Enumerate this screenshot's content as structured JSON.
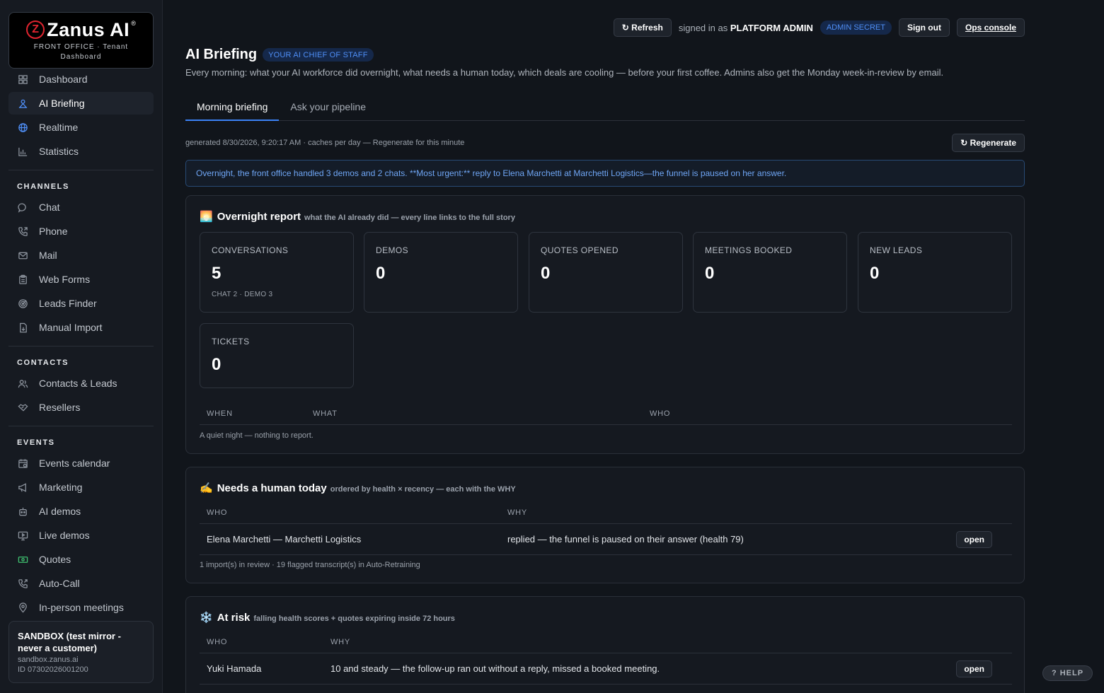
{
  "brand": {
    "name": "Zanus AI",
    "logo_mark": "Z",
    "registered": "®",
    "subtitle": "FRONT OFFICE · Tenant Dashboard"
  },
  "sidebar": {
    "top_items": [
      {
        "label": "Dashboard",
        "icon": "dashboard-icon",
        "active": false
      },
      {
        "label": "AI Briefing",
        "icon": "briefing-icon",
        "active": true
      },
      {
        "label": "Realtime",
        "icon": "globe-icon",
        "active": false
      },
      {
        "label": "Statistics",
        "icon": "bar-chart-icon",
        "active": false
      }
    ],
    "channels_heading": "CHANNELS",
    "channels": [
      {
        "label": "Chat",
        "icon": "chat-icon"
      },
      {
        "label": "Phone",
        "icon": "phone-icon"
      },
      {
        "label": "Mail",
        "icon": "mail-icon"
      },
      {
        "label": "Web Forms",
        "icon": "clipboard-icon"
      },
      {
        "label": "Leads Finder",
        "icon": "radar-icon"
      },
      {
        "label": "Manual Import",
        "icon": "import-icon"
      }
    ],
    "contacts_heading": "CONTACTS",
    "contacts": [
      {
        "label": "Contacts & Leads",
        "icon": "users-icon"
      },
      {
        "label": "Resellers",
        "icon": "handshake-icon"
      }
    ],
    "events_heading": "EVENTS",
    "events": [
      {
        "label": "Events calendar",
        "icon": "calendar-icon"
      },
      {
        "label": "Marketing",
        "icon": "megaphone-icon"
      },
      {
        "label": "AI demos",
        "icon": "robot-icon"
      },
      {
        "label": "Live demos",
        "icon": "monitor-icon"
      },
      {
        "label": "Quotes",
        "icon": "money-icon"
      },
      {
        "label": "Auto-Call",
        "icon": "phone-forward-icon"
      },
      {
        "label": "In-person meetings",
        "icon": "location-pin-icon"
      }
    ]
  },
  "tenant": {
    "name": "SANDBOX (test mirror - never a customer)",
    "domain": "sandbox.zanus.ai",
    "id": "ID 07302026001200"
  },
  "topbar": {
    "refresh_label": "↻ Refresh",
    "signed_in_prefix": "signed in as",
    "user": "PLATFORM ADMIN",
    "role_badge": "ADMIN SECRET",
    "sign_out_label": "Sign out",
    "ops_console_label": "Ops console"
  },
  "page": {
    "title": "AI Briefing",
    "badge": "YOUR AI CHIEF OF STAFF",
    "subtitle": "Every morning: what your AI workforce did overnight, what needs a human today, which deals are cooling — before your first coffee. Admins also get the Monday week-in-review by email."
  },
  "tabs": [
    {
      "label": "Morning briefing",
      "active": true
    },
    {
      "label": "Ask your pipeline",
      "active": false
    }
  ],
  "generated": {
    "text": "generated 8/30/2026, 9:20:17 AM · caches per day — Regenerate for this minute",
    "regenerate_label": "↻ Regenerate"
  },
  "callout": "Overnight, the front office handled 3 demos and 2 chats. **Most urgent:** reply to Elena Marchetti at Marchetti Logistics—the funnel is paused on her answer.",
  "overnight": {
    "emoji": "🌅",
    "title": "Overnight report",
    "subtitle": "what the AI already did — every line links to the full story",
    "stats": [
      {
        "label": "CONVERSATIONS",
        "value": "5",
        "sub": "CHAT 2 · DEMO 3"
      },
      {
        "label": "DEMOS",
        "value": "0",
        "sub": ""
      },
      {
        "label": "QUOTES OPENED",
        "value": "0",
        "sub": ""
      },
      {
        "label": "MEETINGS BOOKED",
        "value": "0",
        "sub": ""
      },
      {
        "label": "NEW LEADS",
        "value": "0",
        "sub": ""
      },
      {
        "label": "TICKETS",
        "value": "0",
        "sub": ""
      }
    ],
    "columns": [
      "WHEN",
      "WHAT",
      "WHO"
    ],
    "empty_text": "A quiet night — nothing to report."
  },
  "needs_human": {
    "emoji": "✍️",
    "title": "Needs a human today",
    "subtitle": "ordered by health × recency — each with the WHY",
    "columns": [
      "WHO",
      "WHY"
    ],
    "rows": [
      {
        "who": "Elena Marchetti — Marchetti Logistics",
        "why": "replied — the funnel is paused on their answer (health 79)",
        "action": "open"
      }
    ],
    "footer": "1 import(s) in review · 19 flagged transcript(s) in Auto-Retraining"
  },
  "at_risk": {
    "emoji": "❄️",
    "title": "At risk",
    "subtitle": "falling health scores + quotes expiring inside 72 hours",
    "columns": [
      "WHO",
      "WHY"
    ],
    "rows": [
      {
        "who": "Yuki Hamada",
        "why": "10 and steady — the follow-up ran out without a reply, missed a booked meeting.",
        "action": "open"
      }
    ]
  },
  "help_label": "? HELP",
  "colors": {
    "accent": "#3b82f6",
    "brand_red": "#e0242f",
    "badge_blue": "#4f8ff7"
  }
}
